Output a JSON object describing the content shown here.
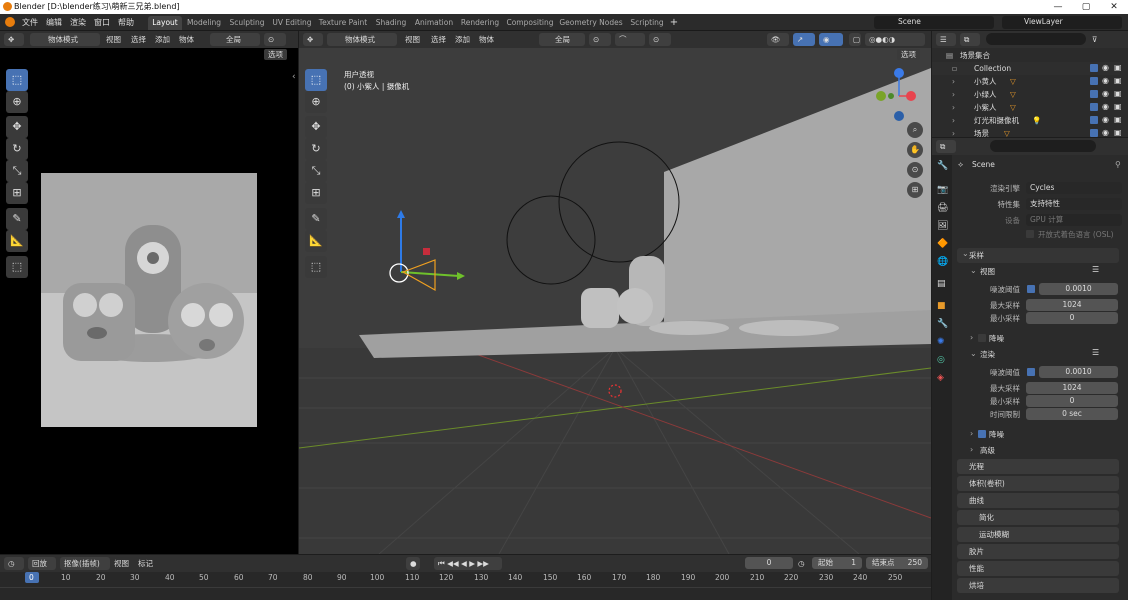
{
  "window": {
    "title": "Blender [D:\\blender练习\\萌新三兄弟.blend]",
    "min": "—",
    "max": "▢",
    "close": "✕"
  },
  "menu": [
    "文件",
    "编辑",
    "渲染",
    "窗口",
    "帮助"
  ],
  "workspaces": [
    "Layout",
    "Modeling",
    "Sculpting",
    "UV Editing",
    "Texture Paint",
    "Shading",
    "Animation",
    "Rendering",
    "Compositing",
    "Geometry Nodes",
    "Scripting",
    "+"
  ],
  "scene": {
    "name": "Scene",
    "viewlayer": "ViewLayer"
  },
  "left_header": {
    "mode": "物体模式",
    "items": [
      "视图",
      "选择",
      "添加",
      "物体"
    ],
    "global": "全局",
    "options": "选项"
  },
  "vp_header": {
    "mode": "物体模式",
    "items": [
      "视图",
      "选择",
      "添加",
      "物体"
    ],
    "global": "全局",
    "options": "选项"
  },
  "viewport": {
    "title": "用户透视",
    "sub": "(0) 小紫人 | 摄像机"
  },
  "outliner": {
    "search": "",
    "root": "场景集合",
    "rows": [
      {
        "name": "Collection",
        "indent": 1
      },
      {
        "name": "小黄人",
        "indent": 2
      },
      {
        "name": "小绿人",
        "indent": 2
      },
      {
        "name": "小紫人",
        "indent": 2
      },
      {
        "name": "灯光和摄像机",
        "indent": 2
      },
      {
        "name": "场景",
        "indent": 2
      }
    ]
  },
  "props": {
    "scene_label": "Scene",
    "engine_label": "渲染引擎",
    "engine": "Cycles",
    "feature_label": "特性集",
    "feature": "支持特性",
    "device_label": "设备",
    "device": "GPU 计算",
    "osl": "开放式着色语言 (OSL)",
    "sampling": "采样",
    "viewport": "视图",
    "noise_th": "噪波阈值",
    "noise_val": "0.0010",
    "max_samples": "最大采样",
    "max_val": "1024",
    "min_samples": "最小采样",
    "min_val": "0",
    "denoise": "降噪",
    "render": "渲染",
    "noise_val2": "0.0010",
    "max_val2": "1024",
    "min_val2": "0",
    "time_limit": "时间限制",
    "time_val": "0 sec",
    "denoise2": "降噪",
    "advanced": "高级",
    "sections": [
      "光程",
      "体积(卷积)",
      "曲线",
      "简化",
      "运动模糊",
      "胶片",
      "性能",
      "烘培"
    ]
  },
  "timeline": {
    "playback": "回放",
    "keying": "抠像(插帧)",
    "view": "视图",
    "marker": "标记",
    "frame": "0",
    "start_label": "起始",
    "start": "1",
    "end_label": "结束点",
    "end": "250",
    "ticks": [
      "0",
      "10",
      "20",
      "30",
      "40",
      "50",
      "60",
      "70",
      "80",
      "90",
      "100",
      "110",
      "120",
      "130",
      "140",
      "150",
      "160",
      "170",
      "180",
      "190",
      "200",
      "210",
      "220",
      "230",
      "240",
      "250"
    ]
  }
}
